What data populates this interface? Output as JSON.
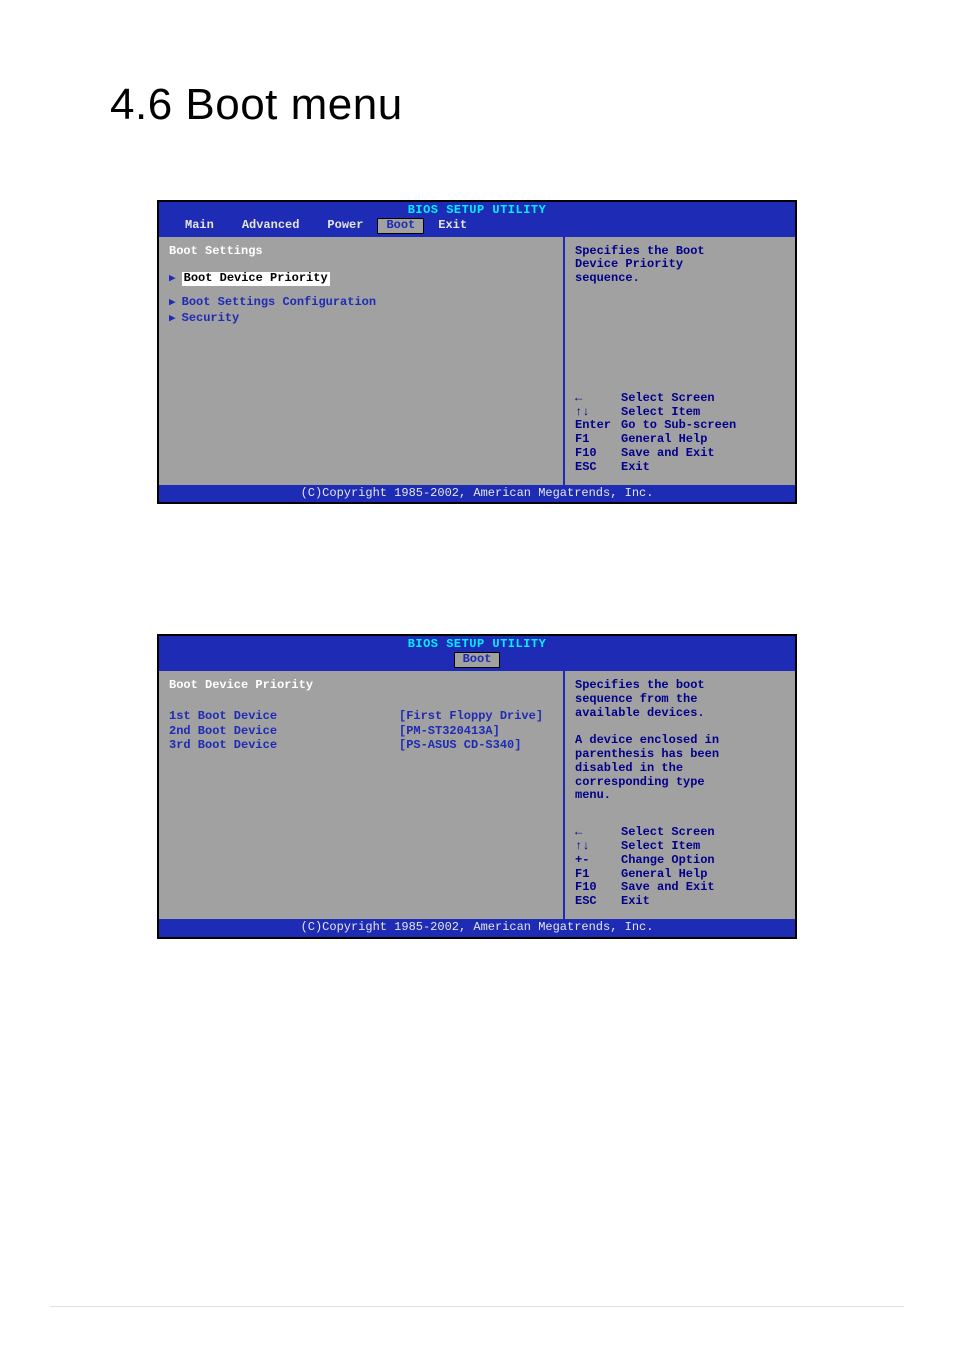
{
  "page_title": "4.6    Boot menu",
  "bios1": {
    "brand": "BIOS SETUP UTILITY",
    "tabs": [
      "Main",
      "Advanced",
      "Power",
      "Boot",
      "Exit"
    ],
    "active_tab_index": 3,
    "section_title": "Boot Settings",
    "items": [
      {
        "label": "Boot Device Priority",
        "selected": true
      },
      {
        "label": "Boot Settings Configuration",
        "selected": false
      },
      {
        "label": "Security",
        "selected": false
      }
    ],
    "help_text": "Specifies the Boot\nDevice Priority\nsequence.",
    "key_hints": [
      {
        "key_icon": "left-arrow-icon",
        "key": "←",
        "label": "Select Screen"
      },
      {
        "key_icon": "updown-arrows-icon",
        "key": "↑↓",
        "label": "Select Item"
      },
      {
        "key_icon": "",
        "key": "Enter",
        "label": "Go to Sub-screen"
      },
      {
        "key_icon": "",
        "key": "F1",
        "label": "General Help"
      },
      {
        "key_icon": "",
        "key": "F10",
        "label": "Save and Exit"
      },
      {
        "key_icon": "",
        "key": "ESC",
        "label": "Exit"
      }
    ],
    "footer": "(C)Copyright 1985-2002, American Megatrends, Inc."
  },
  "bios2": {
    "brand": "BIOS SETUP UTILITY",
    "tabs": [
      "Boot"
    ],
    "active_tab_index": 0,
    "section_title": "Boot Device Priority",
    "rows": [
      {
        "key": "1st Boot Device",
        "value": "[First Floppy Drive]"
      },
      {
        "key": "2nd Boot Device",
        "value": "[PM-ST320413A]"
      },
      {
        "key": "3rd Boot Device",
        "value": "[PS-ASUS CD-S340]"
      }
    ],
    "help_text": "Specifies the boot\nsequence from the\navailable devices.\n\nA device enclosed in\nparenthesis has been\ndisabled in the\ncorresponding type\nmenu.",
    "key_hints": [
      {
        "key_icon": "left-arrow-icon",
        "key": "←",
        "label": "Select Screen"
      },
      {
        "key_icon": "updown-arrows-icon",
        "key": "↑↓",
        "label": "Select Item"
      },
      {
        "key_icon": "",
        "key": "+-",
        "label": "Change Option"
      },
      {
        "key_icon": "",
        "key": "F1",
        "label": "General Help"
      },
      {
        "key_icon": "",
        "key": "F10",
        "label": "Save and Exit"
      },
      {
        "key_icon": "",
        "key": "ESC",
        "label": "Exit"
      }
    ],
    "footer": "(C)Copyright 1985-2002, American Megatrends, Inc."
  }
}
